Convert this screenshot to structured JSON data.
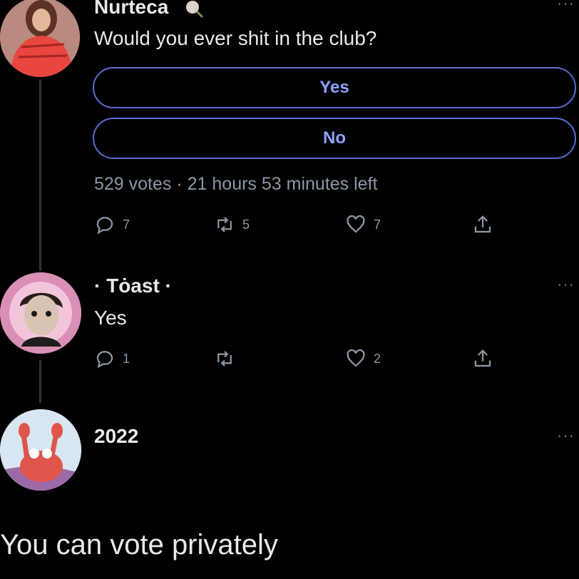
{
  "tweet1": {
    "author": "Nurteca",
    "badge_icon": "rose-emoji-icon",
    "text": "Would you ever shit in the club?",
    "poll": {
      "options": [
        {
          "label": "Yes"
        },
        {
          "label": "No"
        }
      ],
      "meta": "529 votes · 21 hours 53 minutes left"
    },
    "actions": {
      "reply_count": "7",
      "retweet_count": "5",
      "like_count": "7"
    }
  },
  "tweet2": {
    "author": "· Tȯast ·",
    "text": "Yes",
    "actions": {
      "reply_count": "1",
      "retweet_count": "",
      "like_count": "2"
    }
  },
  "tweet3": {
    "text": "2022"
  },
  "caption": "You can vote privately",
  "colors": {
    "background": "#000000",
    "poll_border": "#5a6cd0",
    "poll_text": "#8ea3ff",
    "muted": "#8b98a5"
  }
}
